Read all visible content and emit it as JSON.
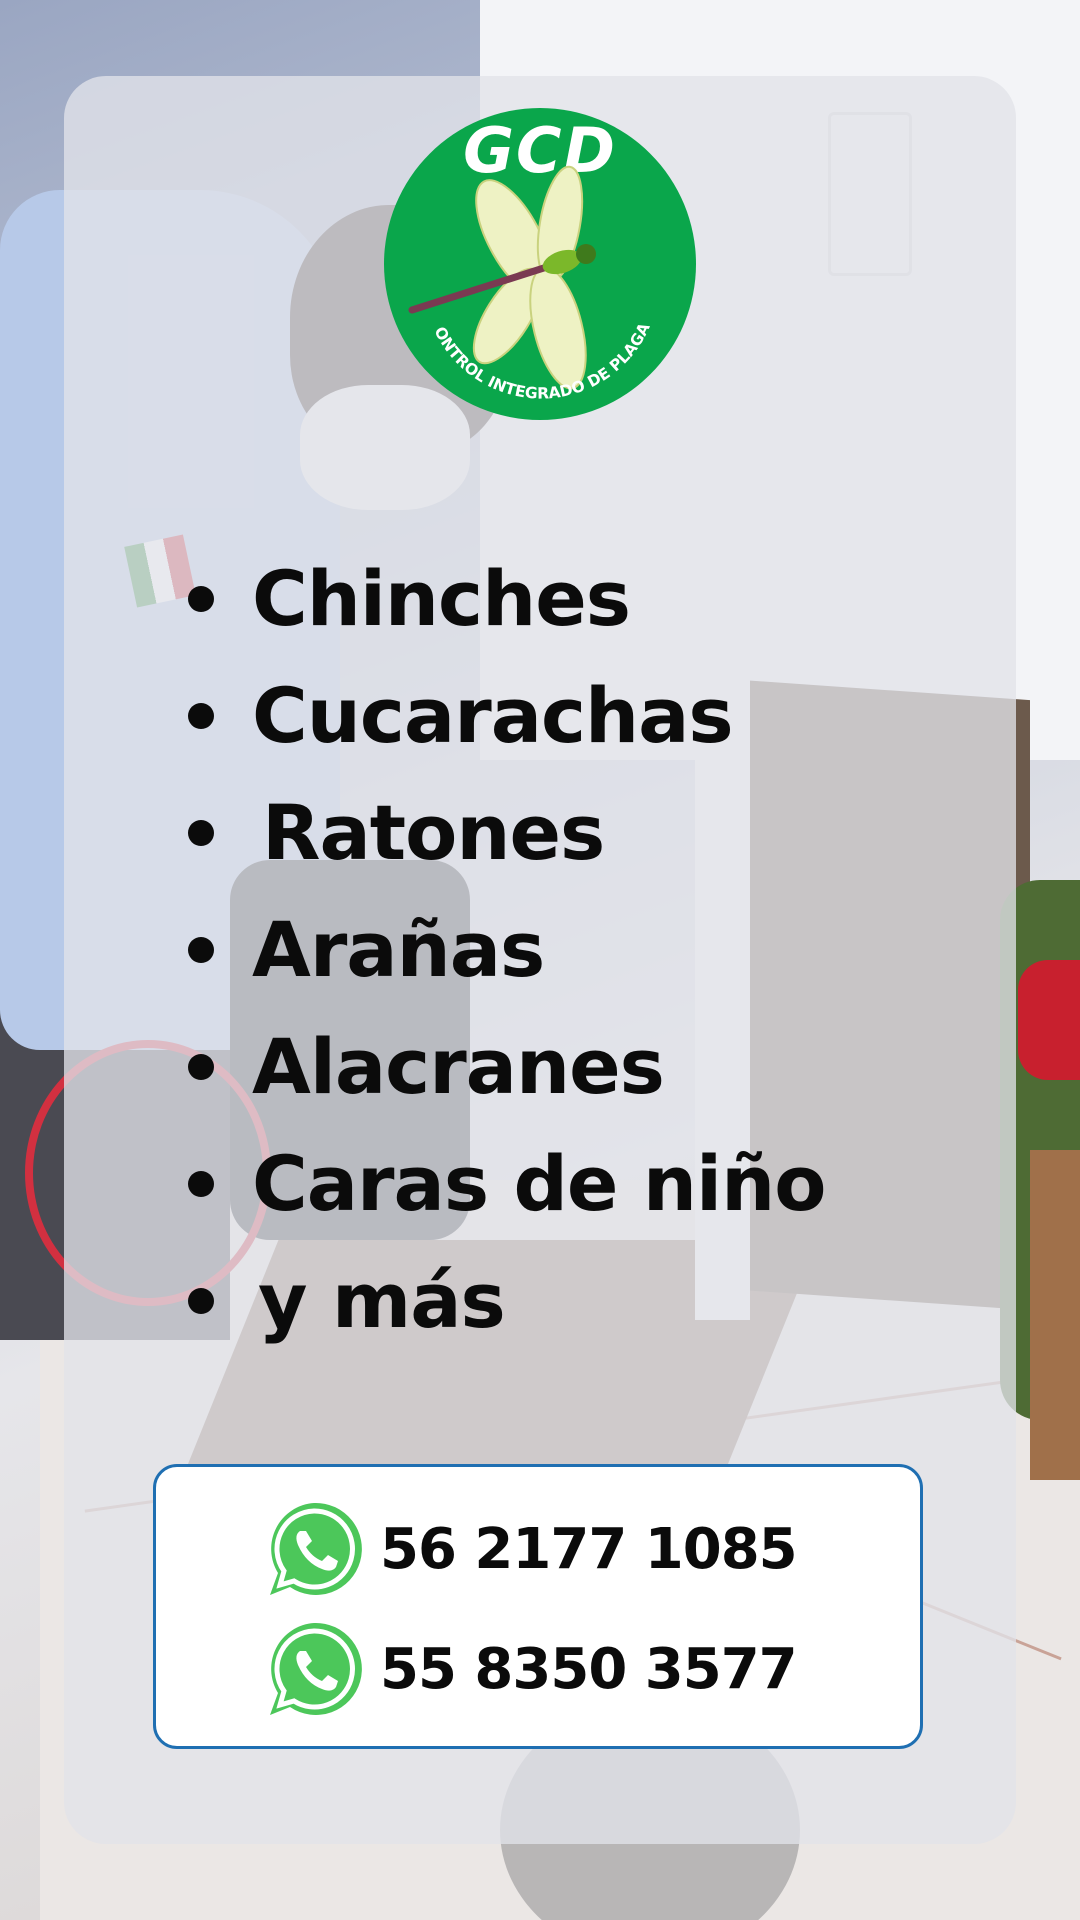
{
  "logo": {
    "brand": "GCD",
    "tagline": "CONTROL INTEGRADO DE PLAGAS",
    "icon": "dragonfly-icon",
    "colors": {
      "circle": "#0aa64b",
      "wings": "#eef2c4",
      "body": "#7bb82a"
    }
  },
  "pests": [
    {
      "label": "Chinches"
    },
    {
      "label": "Cucarachas"
    },
    {
      "label": "Ratones"
    },
    {
      "label": "Arañas"
    },
    {
      "label": "Alacranes"
    },
    {
      "label": "Caras de niño"
    },
    {
      "label": "y más"
    }
  ],
  "contacts": [
    {
      "icon": "whatsapp-icon",
      "number": "56 2177 1085"
    },
    {
      "icon": "whatsapp-icon",
      "number": "55 8350 3577"
    }
  ],
  "colors": {
    "whatsapp": "#4cc75a",
    "contact_border": "#1f6fb2",
    "text": "#0b0b0b"
  }
}
